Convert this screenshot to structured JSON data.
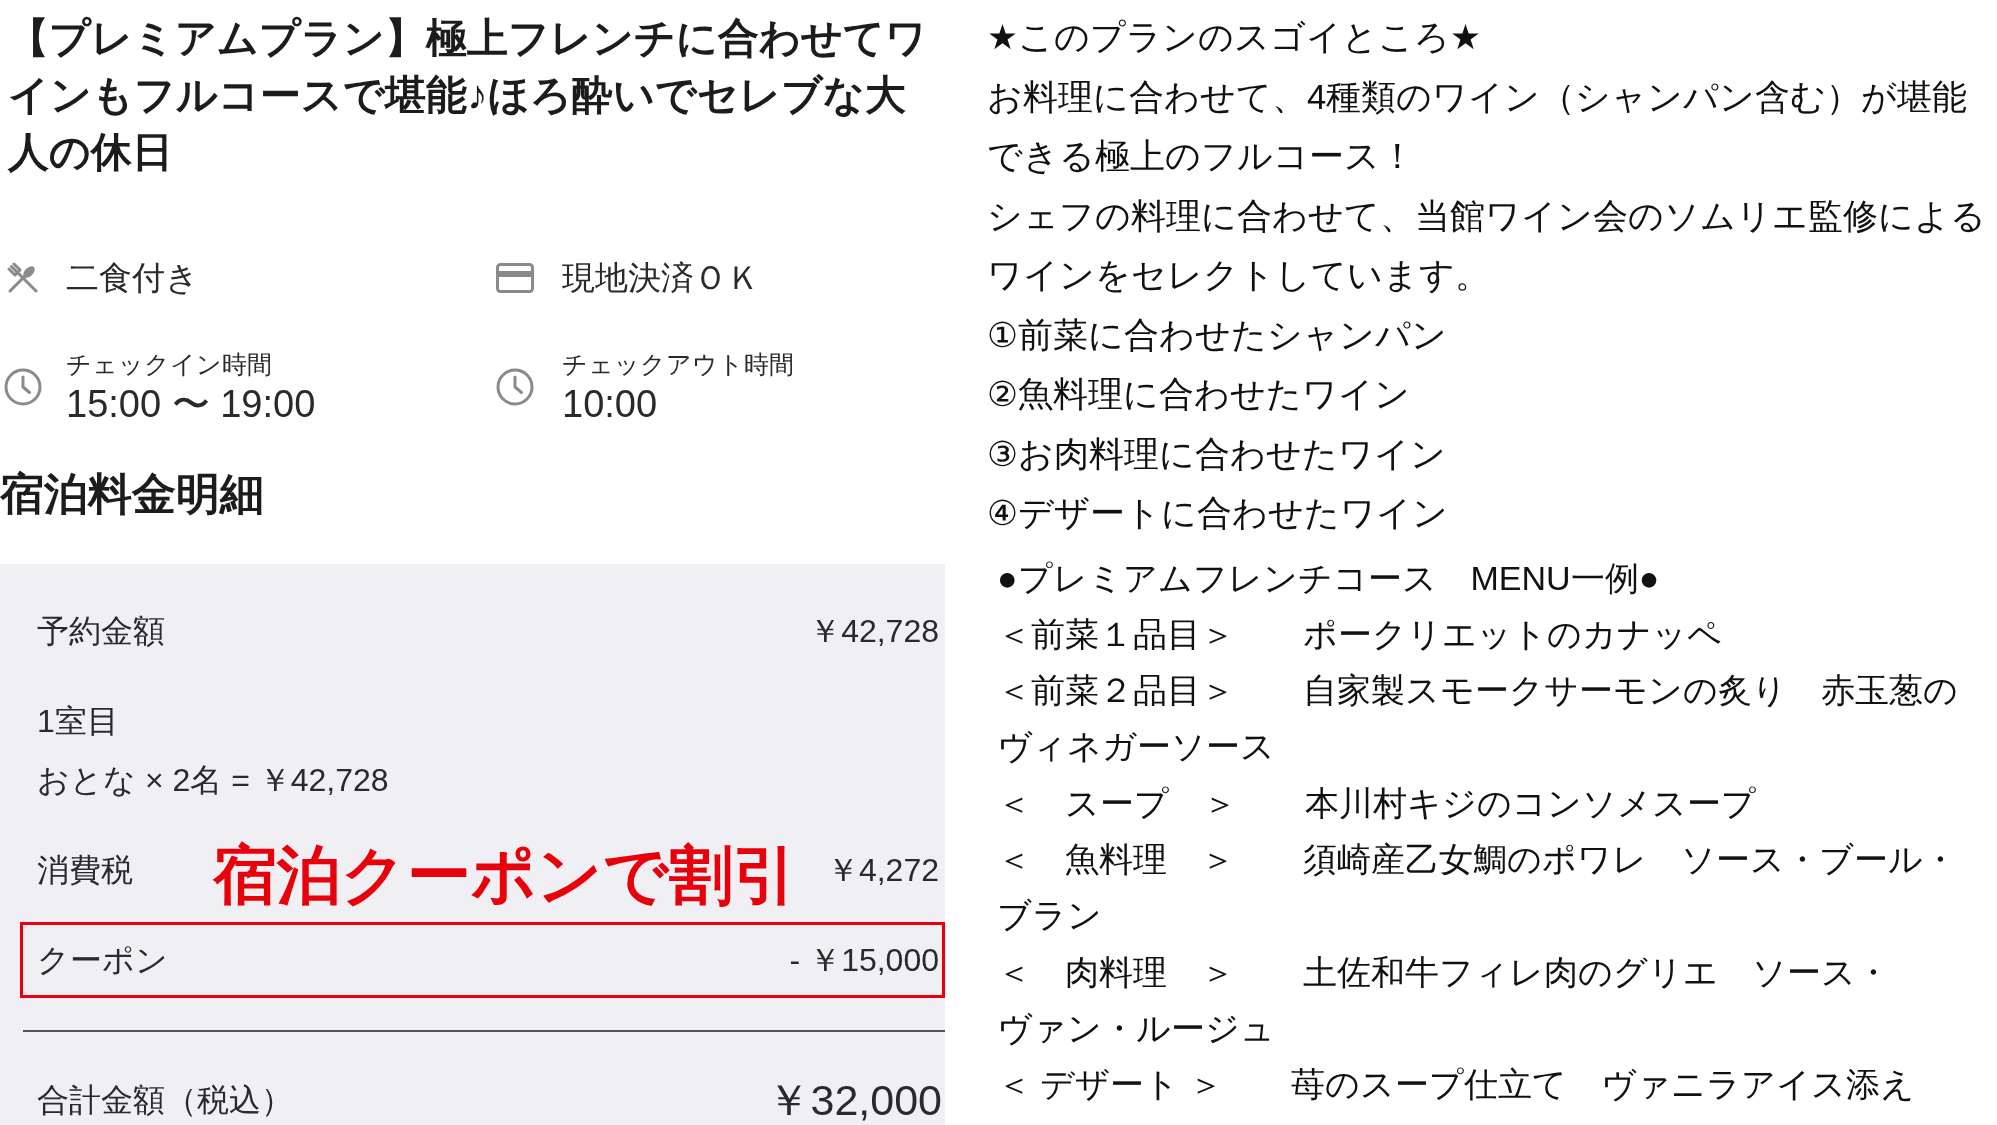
{
  "plan": {
    "title": "【プレミアムプラン】極上フレンチに合わせてワインもフルコースで堪能♪ほろ酔いでセレブな大人の休日",
    "features": [
      {
        "kind": "meal",
        "label": "二食付き"
      },
      {
        "kind": "payment",
        "label": "現地決済ＯＫ"
      }
    ],
    "times": [
      {
        "label": "チェックイン時間",
        "value": "15:00 〜 19:00"
      },
      {
        "label": "チェックアウト時間",
        "value": "10:00"
      }
    ]
  },
  "price_breakdown": {
    "heading": "宿泊料金明細",
    "annotation": "宿泊クーポンで割引",
    "rows": [
      {
        "kind": "item",
        "label": "予約金額",
        "value": "￥42,728",
        "highlighted": false
      },
      {
        "kind": "room",
        "label": "1室目",
        "detail": "おとな × 2名 = ￥42,728",
        "highlighted": false
      },
      {
        "kind": "item",
        "label": "消費税",
        "value": "￥4,272",
        "highlighted": false
      },
      {
        "kind": "item",
        "label": "クーポン",
        "value": "- ￥15,000",
        "highlighted": true
      }
    ],
    "total": {
      "label": "合計金額（税込）",
      "value": "￥32,000"
    }
  },
  "plan_highlights": {
    "heading": "★このプランのスゴイところ★",
    "paragraphs": [
      "お料理に合わせて、4種類のワイン（シャンパン含む）が堪能できる極上のフルコース！",
      "シェフの料理に合わせて、当館ワイン会のソムリエ監修によるワインをセレクトしています。"
    ],
    "wines": [
      "①前菜に合わせたシャンパン",
      "②魚料理に合わせたワイン",
      "③お肉料理に合わせたワイン",
      "④デザートに合わせたワイン"
    ]
  },
  "menu": {
    "heading": "●プレミアムフレンチコース　MENU一例●",
    "courses": [
      "＜前菜１品目＞　　ポークリエットのカナッペ",
      "＜前菜２品目＞　　自家製スモークサーモンの炙り　赤玉葱のヴィネガーソース",
      "＜　スープ　＞　　本川村キジのコンソメスープ",
      "＜　魚料理　＞　　須崎産乙女鯛のポワレ　ソース・ブール・ブラン",
      "＜　肉料理　＞　　土佐和牛フィレ肉のグリエ　ソース・ヴァン・ルージュ",
      "＜ デザート ＞　　苺のスープ仕立て　ヴァニラアイス添え"
    ]
  }
}
